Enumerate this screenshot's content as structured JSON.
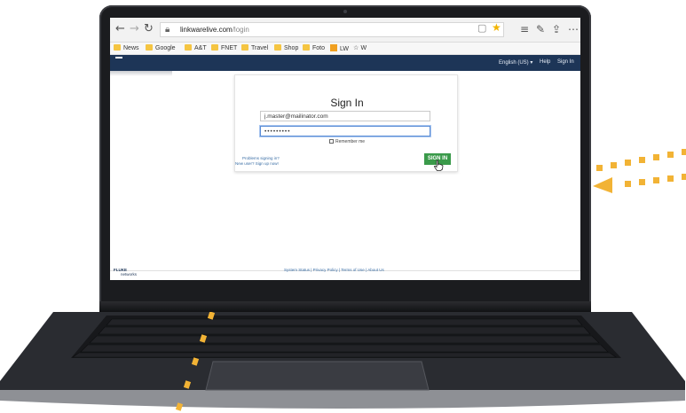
{
  "browser": {
    "url_host": "linkwarelive.com",
    "url_path": "/login",
    "favorites": [
      {
        "label": "News"
      },
      {
        "label": "Google"
      },
      {
        "label": "A&T"
      },
      {
        "label": "FNET"
      },
      {
        "label": "Travel"
      },
      {
        "label": "Shop"
      },
      {
        "label": "Foto"
      },
      {
        "label": "LW"
      },
      {
        "label": "W"
      }
    ]
  },
  "site_header": {
    "language": "English (US) ▾",
    "help": "Help",
    "sign_in": "Sign In"
  },
  "signin_form": {
    "title": "Sign In",
    "username_value": "j.master@mailinator.com",
    "password_value": "•••••••••",
    "remember_label": "Remember me",
    "problems_link": "Problems signing in?",
    "new_user_link": "New user? Sign up now!",
    "button_label": "SIGN IN"
  },
  "footer": {
    "logo_line1": "FLUKE",
    "logo_line2": "networks",
    "links": "System Status | Privacy Policy | Terms of Use | About Us"
  },
  "colors": {
    "header_navy": "#1d3557",
    "signin_green": "#3a9a4a",
    "arrow_amber": "#f2b335",
    "star_gold": "#f2b400"
  },
  "icons": [
    "back-arrow-icon",
    "forward-arrow-icon",
    "refresh-icon",
    "lock-icon",
    "reader-view-icon",
    "favorite-star-icon",
    "hub-icon",
    "pen-icon",
    "share-icon",
    "more-icon",
    "folder-icon",
    "pointer-hand-icon"
  ]
}
